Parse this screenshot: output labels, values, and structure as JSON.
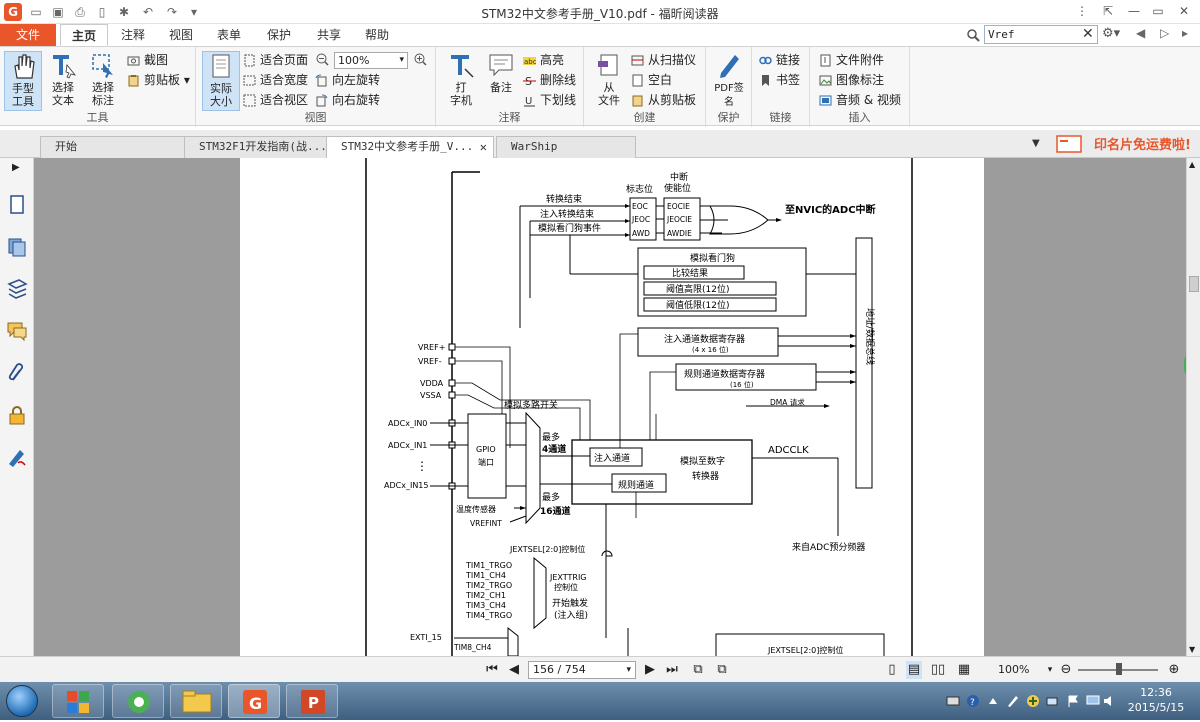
{
  "window": {
    "title": "STM32中文参考手册_V10.pdf - 福昕阅读器"
  },
  "menubar": {
    "file": "文件",
    "items": [
      "主页",
      "注释",
      "视图",
      "表单",
      "保护",
      "共享",
      "帮助"
    ],
    "search_value": "Vref"
  },
  "ribbon": {
    "groups": {
      "tools": {
        "caption": "工具",
        "hand_tool": "手型\n工具",
        "select_text": "选择\n文本",
        "select_annotation": "选择\n标注",
        "screenshot": "截图",
        "clipboard": "剪贴板"
      },
      "view": {
        "caption": "视图",
        "actual_size": "实际\n大小",
        "fit_page": "适合页面",
        "fit_width": "适合宽度",
        "fit_view": "适合视区",
        "zoom": "100%",
        "rotate_left": "向左旋转",
        "rotate_right": "向右旋转"
      },
      "comment": {
        "caption": "注释",
        "typewriter": "打\n字机",
        "note": "备注",
        "highlight": "高亮",
        "strikeout": "删除线",
        "underline": "下划线"
      },
      "create": {
        "caption": "创建",
        "from_file": "从\n文件",
        "from_scanner": "从扫描仪",
        "blank": "空白",
        "from_clipboard": "从剪贴板"
      },
      "protect": {
        "caption": "保护",
        "pdf_sign": "PDF签\n名"
      },
      "link": {
        "caption": "链接",
        "link": "链接",
        "bookmark": "书签"
      },
      "insert": {
        "caption": "插入",
        "file_attachment": "文件附件",
        "image_annotation": "图像标注",
        "audio_video": "音频 & 视频"
      }
    }
  },
  "tabs": [
    {
      "label": "开始"
    },
    {
      "label": "STM32F1开发指南(战..."
    },
    {
      "label": "STM32中文参考手册_V..."
    },
    {
      "label": "WarShip STM32F1_V3..."
    }
  ],
  "promo": "印名片免运费啦!",
  "statusbar": {
    "page_indicator": "156 / 754",
    "zoom": "100%"
  },
  "clock": {
    "time": "12:36",
    "date": "2015/5/15"
  },
  "diagram": {
    "labels": {
      "conv_end": "转换结束",
      "inj_conv_end": "注入转换结束",
      "awd_event": "模拟看门狗事件",
      "flag_bits": "标志位",
      "int_enable_1": "中断",
      "int_enable_2": "使能位",
      "eoc": "EOC",
      "jeoc": "JEOC",
      "awd": "AWD",
      "eocie": "EOCIE",
      "jeocie": "JEOCIE",
      "awdie": "AWDIE",
      "to_nvic": "至NVIC的ADC中断",
      "awd_title": "模拟看门狗",
      "compare_result": "比较结果",
      "high_threshold": "阈值高限(12位)",
      "low_threshold": "阈值低限(12位)",
      "inj_data_reg": "注入通道数据寄存器",
      "inj_data_reg_size": "(4 x 16 位)",
      "reg_data_reg": "规则通道数据寄存器",
      "reg_data_reg_size": "(16 位)",
      "dma_req": "DMA 请求",
      "bus": "地址/数据总线",
      "vref_plus": "VREF+",
      "vref_minus": "VREF-",
      "vdda": "VDDA",
      "vssa": "VSSA",
      "analog_mux": "模拟多路开关",
      "adc_in0": "ADCx_IN0",
      "adc_in1": "ADCx_IN1",
      "adc_in15": "ADCx_IN15",
      "gpio_port": "GPIO\n端口",
      "up_to_4": "最多",
      "ch4": "4通道",
      "up_to_16": "最多",
      "ch16": "16通道",
      "inj_ch": "注入通道",
      "reg_ch": "规则通道",
      "adc_conv": "模拟至数字\n转换器",
      "adcclk": "ADCCLK",
      "temp_sensor": "温度传感器",
      "vrefint": "VREFINT",
      "from_prescaler": "来自ADC预分频器",
      "jextsel": "JEXTSEL[2:0]控制位",
      "tim1_trgo": "TIM1_TRGO",
      "tim1_ch4": "TIM1_CH4",
      "tim2_trgo": "TIM2_TRGO",
      "tim2_ch1": "TIM2_CH1",
      "tim3_ch4": "TIM3_CH4",
      "tim4_trgo": "TIM4_TRGO",
      "jexttrig": "JEXTTRIG\n控制位",
      "start_trigger": "开始触发\n(注入组)",
      "exti_15": "EXTI_15",
      "tim8_ch4": "TIM8_CH4",
      "jextsel_bottom": "JEXTSEL[2:0]控制位"
    }
  }
}
